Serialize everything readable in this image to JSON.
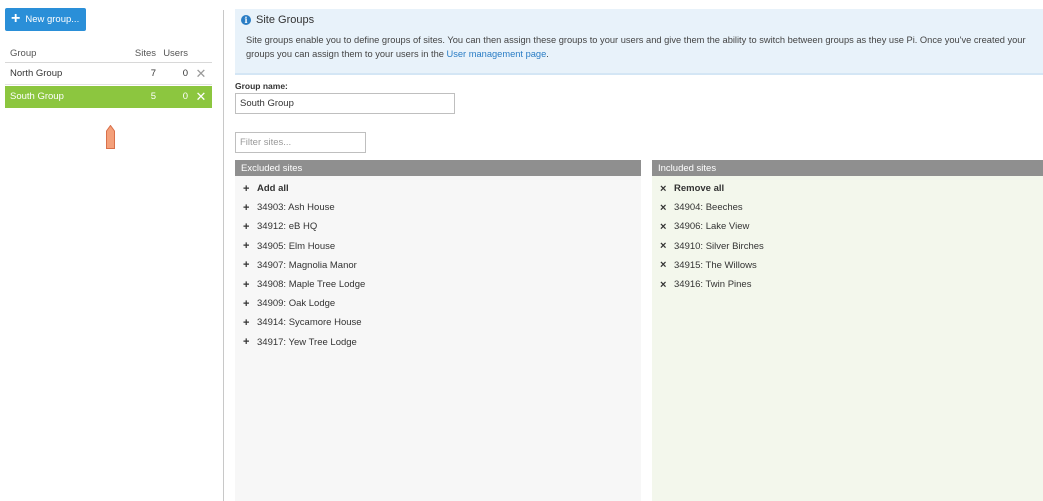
{
  "left_panel": {
    "new_group_label": "New group...",
    "headers": {
      "group": "Group",
      "sites": "Sites",
      "users": "Users"
    },
    "groups": [
      {
        "name": "North Group",
        "sites": "7",
        "users": "0"
      },
      {
        "name": "South Group",
        "sites": "5",
        "users": "0"
      }
    ],
    "active_group_index": 1
  },
  "info": {
    "title": "Site Groups",
    "body_text": "Site groups enable you to define groups of sites. You can then assign these groups to your users and give them the ability to switch between groups as they use Pi. Once you've created your groups you can assign them to your users in the ",
    "link_text": "User management page",
    "body_end": "."
  },
  "group_name": {
    "label": "Group name:",
    "value": "South Group"
  },
  "filter": {
    "placeholder": "Filter sites..."
  },
  "excluded": {
    "header": "Excluded sites",
    "add_all_label": "Add all",
    "sites": [
      "34903: Ash House",
      "34912: eB HQ",
      "34905: Elm House",
      "34907: Magnolia Manor",
      "34908: Maple Tree Lodge",
      "34909: Oak Lodge",
      "34914: Sycamore House",
      "34917: Yew Tree Lodge"
    ]
  },
  "included": {
    "header": "Included sites",
    "remove_all_label": "Remove all",
    "sites": [
      "34904: Beeches",
      "34906: Lake View",
      "34910: Silver Birches",
      "34915: The Willows",
      "34916: Twin Pines"
    ]
  },
  "colors": {
    "accent_blue": "#2a8fd8",
    "active_green": "#8cc63f",
    "pointer_orange": "#f4a07a"
  },
  "icons": {
    "plus": "+",
    "remove": "×",
    "info": "i"
  }
}
